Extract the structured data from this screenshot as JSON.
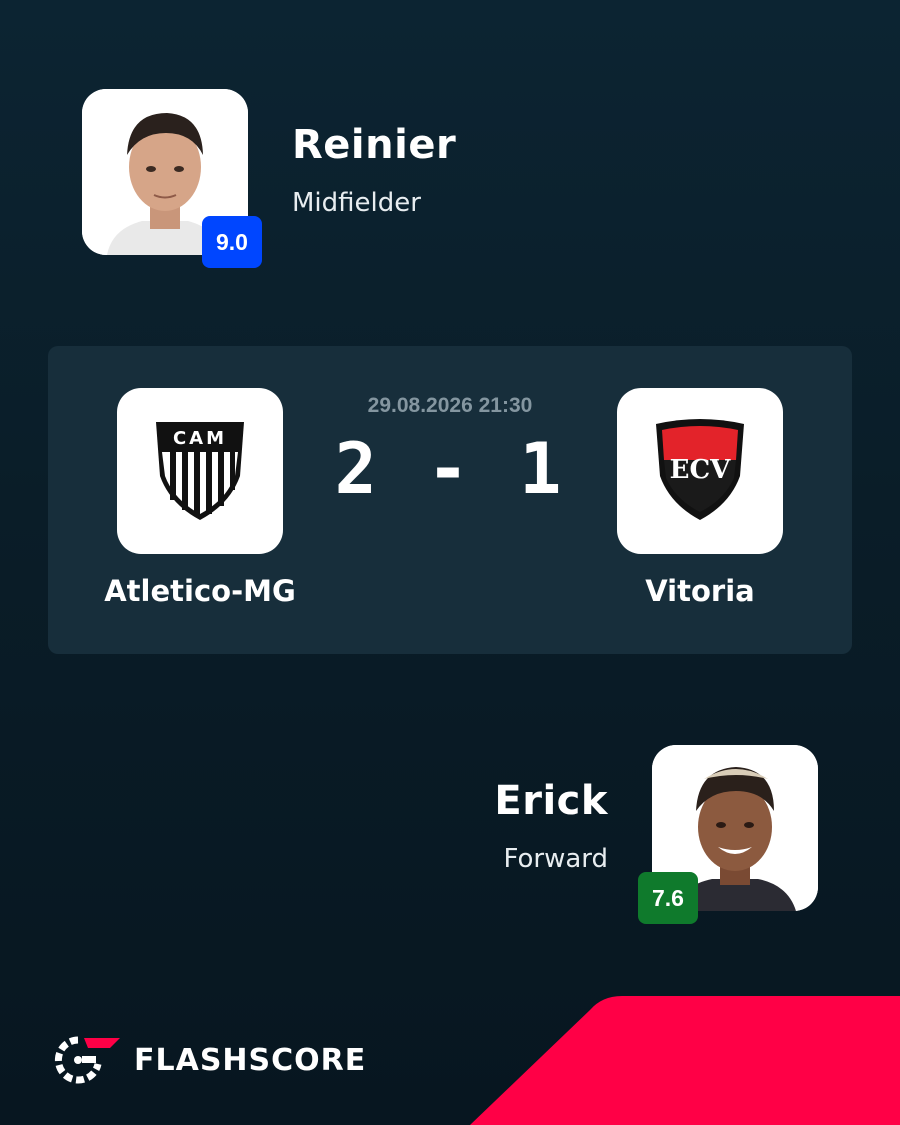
{
  "players": [
    {
      "name": "Reinier",
      "position": "Midfielder",
      "rating": "9.0",
      "rating_color": "#0046ff"
    },
    {
      "name": "Erick",
      "position": "Forward",
      "rating": "7.6",
      "rating_color": "#0f7a2c"
    }
  ],
  "match": {
    "datetime": "29.08.2026 21:30",
    "score": "2 - 1",
    "home_team": {
      "name": "Atletico-MG",
      "crest_text": "CAM"
    },
    "away_team": {
      "name": "Vitoria",
      "crest_text": "ECV"
    }
  },
  "brand": {
    "name": "FLASHSCORE",
    "accent": "#ff0046"
  }
}
